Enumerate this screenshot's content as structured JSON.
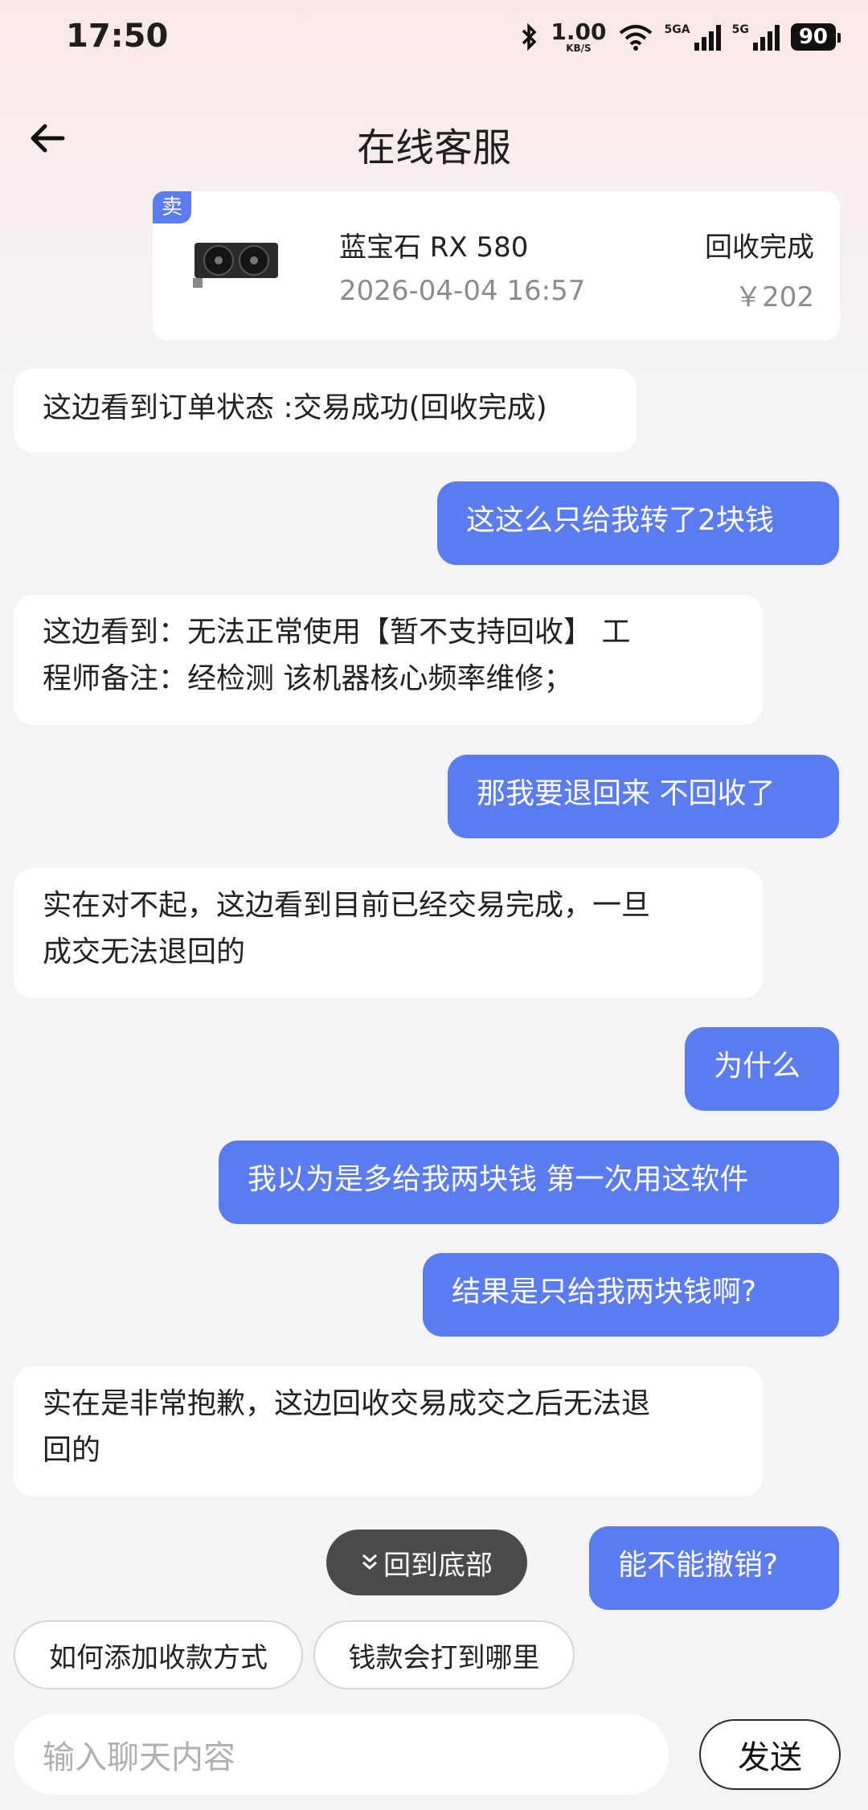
{
  "status_bar": {
    "time": "17:50",
    "net_speed_value": "1.00",
    "net_speed_unit": "KB/S",
    "sim1_label": "5GA",
    "sim2_label": "5G",
    "battery": "90",
    "icons": [
      "bluetooth-icon",
      "wifi-icon",
      "signal-icon",
      "signal-icon",
      "battery-icon"
    ]
  },
  "header": {
    "title": "在线客服",
    "back_icon": "arrow-left-icon"
  },
  "order_card": {
    "tag": "卖",
    "product_name": "蓝宝石 RX 580",
    "date": "2026-04-04 16:57",
    "status": "回收完成",
    "price": "￥202"
  },
  "messages": [
    {
      "from": "agent",
      "text": "这边看到订单状态 :交易成功(回收完成)"
    },
    {
      "from": "user",
      "text": "这这么只给我转了2块钱"
    },
    {
      "from": "agent",
      "line1": "这边看到：无法正常使用【暂不支持回收】 工",
      "line2": "程师备注：经检测 该机器核心频率维修；"
    },
    {
      "from": "user",
      "text": "那我要退回来 不回收了"
    },
    {
      "from": "agent",
      "line1": "实在对不起，这边看到目前已经交易完成，一旦",
      "line2": "成交无法退回的"
    },
    {
      "from": "user",
      "text": "为什么"
    },
    {
      "from": "user",
      "text": "我以为是多给我两块钱 第一次用这软件"
    },
    {
      "from": "user",
      "text": "结果是只给我两块钱啊?"
    },
    {
      "from": "agent",
      "line1": "实在是非常抱歉，这边回收交易成交之后无法退",
      "line2": "回的"
    },
    {
      "from": "user",
      "text": "能不能撤销?"
    }
  ],
  "scroll_to_bottom": {
    "label": "回到底部",
    "icon": "double-chevron-down-icon"
  },
  "quick_replies": [
    "如何添加收款方式",
    "钱款会打到哪里"
  ],
  "composer": {
    "placeholder": "输入聊天内容",
    "send_label": "发送"
  },
  "colors": {
    "accent": "#5b7cf0",
    "bubble_in": "#ffffff",
    "background": "#f4f4f6"
  }
}
